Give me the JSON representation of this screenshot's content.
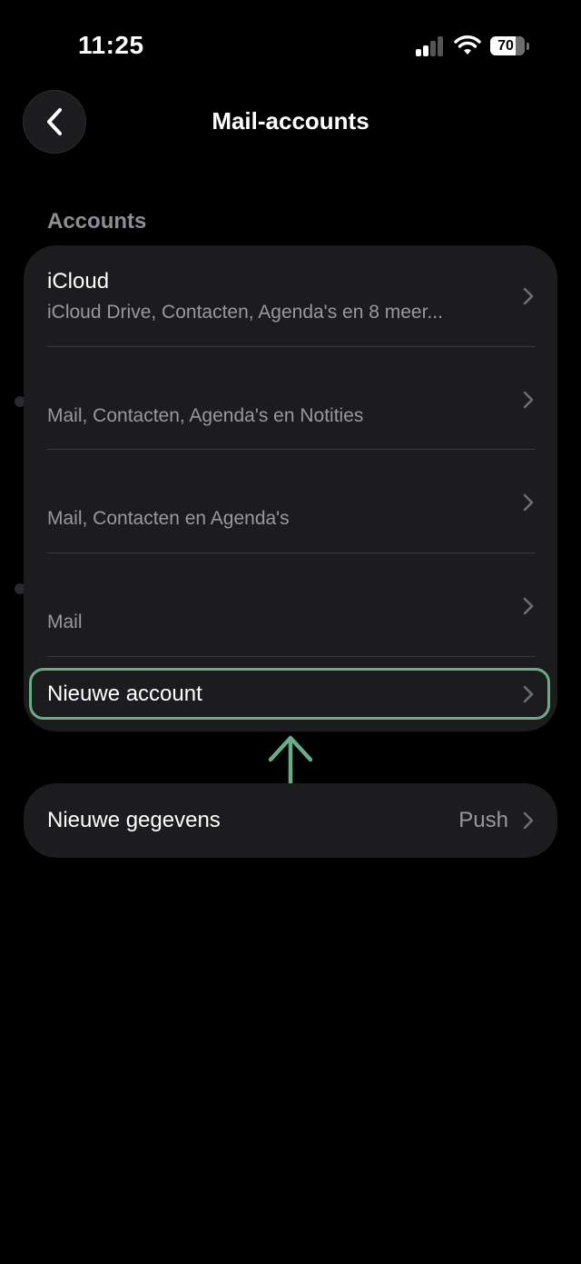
{
  "status_bar": {
    "time": "11:25",
    "battery": "70"
  },
  "nav": {
    "title": "Mail-accounts",
    "back_icon": "chevron-left-icon"
  },
  "section": {
    "header": "Accounts"
  },
  "accounts": [
    {
      "title": "iCloud",
      "subtitle": "iCloud Drive, Contacten, Agenda's en 8 meer..."
    },
    {
      "title": "",
      "subtitle": "Mail, Contacten, Agenda's en Notities"
    },
    {
      "title": "",
      "subtitle": "Mail, Contacten en Agenda's"
    },
    {
      "title": "",
      "subtitle": "Mail"
    }
  ],
  "new_account": {
    "label": "Nieuwe account"
  },
  "fetch": {
    "label": "Nieuwe gegevens",
    "value": "Push"
  },
  "colors": {
    "background": "#000000",
    "card": "#1c1c1e",
    "highlight": "#6aab88",
    "secondary_text": "#98989d"
  }
}
